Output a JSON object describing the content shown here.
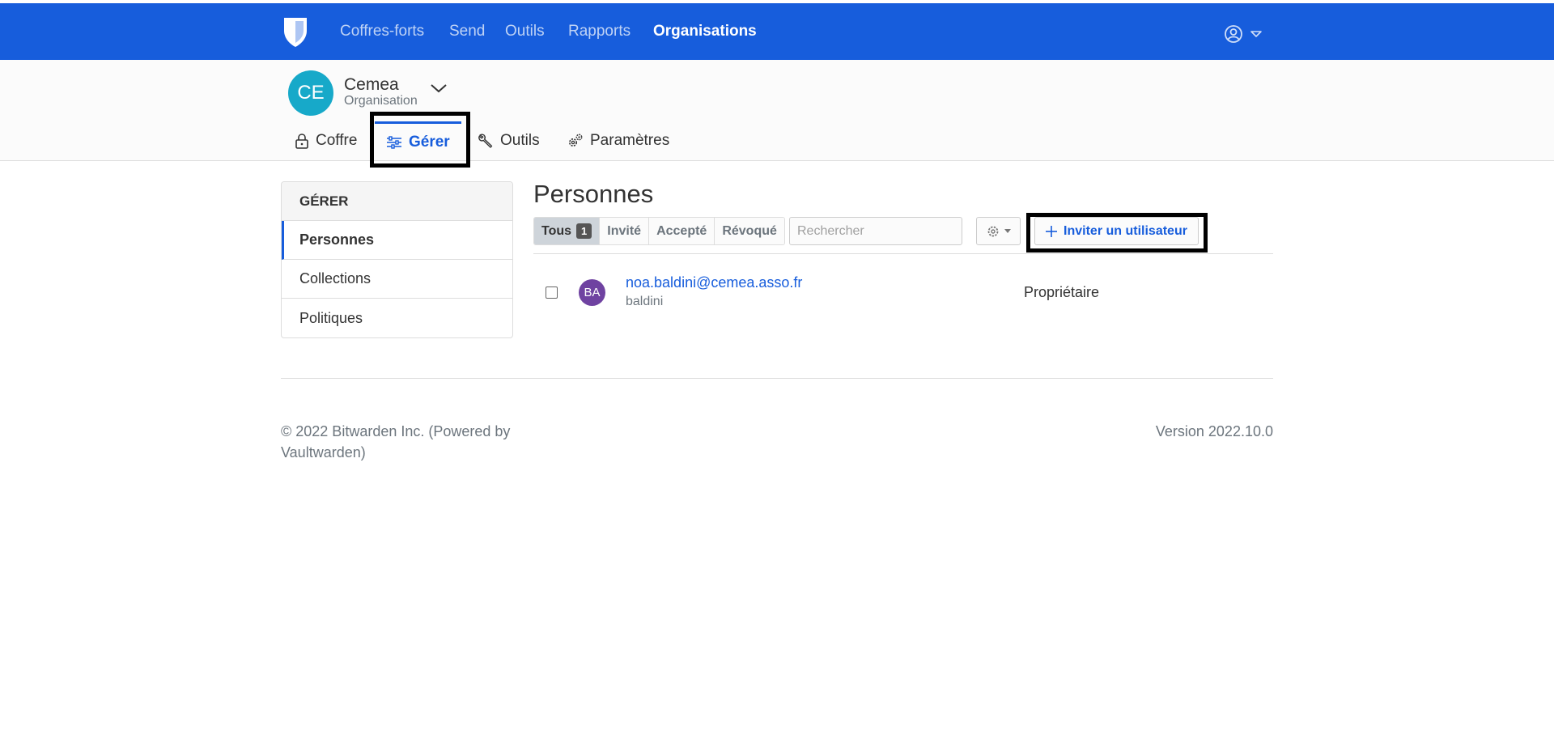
{
  "colors": {
    "brand_blue": "#175ddc",
    "org_avatar_bg": "#17a9c9",
    "user_avatar_bg": "#6f42a1",
    "highlight_box": "#000000"
  },
  "navbar": {
    "logo_icon": "bitwarden-shield-icon",
    "links": [
      {
        "label": "Coffres-forts",
        "active": false
      },
      {
        "label": "Send",
        "active": false
      },
      {
        "label": "Outils",
        "active": false
      },
      {
        "label": "Rapports",
        "active": false
      },
      {
        "label": "Organisations",
        "active": true
      }
    ],
    "user_menu_icon": "user-circle-icon"
  },
  "org": {
    "initials": "CE",
    "name": "Cemea",
    "subtitle": "Organisation",
    "tabs": [
      {
        "label": "Coffre",
        "icon": "lock-icon",
        "active": false
      },
      {
        "label": "Gérer",
        "icon": "sliders-icon",
        "active": true
      },
      {
        "label": "Outils",
        "icon": "wrench-icon",
        "active": false
      },
      {
        "label": "Paramètres",
        "icon": "cogs-icon",
        "active": false
      }
    ]
  },
  "sidebar": {
    "heading": "GÉRER",
    "items": [
      {
        "label": "Personnes",
        "active": true
      },
      {
        "label": "Collections",
        "active": false
      },
      {
        "label": "Politiques",
        "active": false
      }
    ]
  },
  "main": {
    "title": "Personnes",
    "filters": [
      {
        "label": "Tous",
        "count": "1",
        "active": true
      },
      {
        "label": "Invité",
        "active": false
      },
      {
        "label": "Accepté",
        "active": false
      },
      {
        "label": "Révoqué",
        "active": false
      }
    ],
    "search_placeholder": "Rechercher",
    "settings_icon": "gear-icon",
    "invite_label": "Inviter un utilisateur",
    "members": [
      {
        "initials": "BA",
        "email": "noa.baldini@cemea.asso.fr",
        "name": "baldini",
        "role": "Propriétaire"
      }
    ]
  },
  "footer": {
    "copyright": "© 2022 Bitwarden Inc. (Powered by Vaultwarden)",
    "version": "Version 2022.10.0"
  }
}
